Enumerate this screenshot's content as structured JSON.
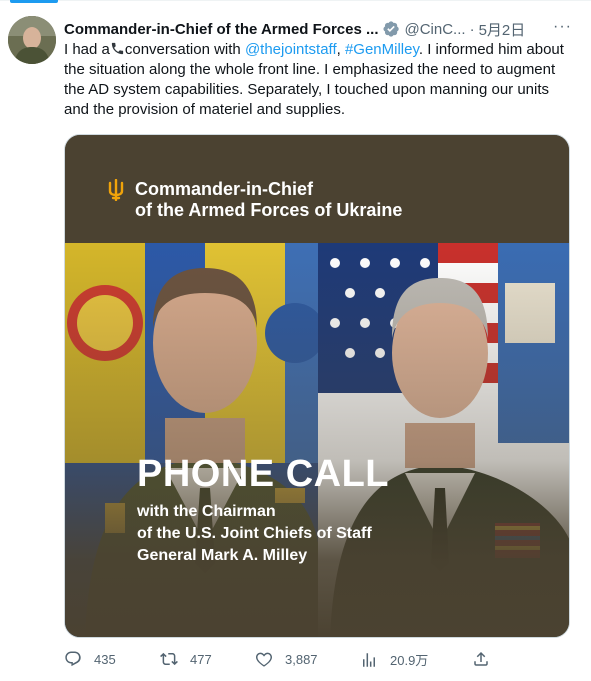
{
  "tweet": {
    "author_name": "Commander-in-Chief of the Armed Forces ...",
    "handle": "@CinC...",
    "separator": "·",
    "date": "5月2日",
    "more": "···",
    "text": {
      "part1": "I had a",
      "part2": "conversation with ",
      "mention": "@thejointstaff",
      "comma": ", ",
      "hashtag": "#GenMilley",
      "part3": ". I informed him about the situation along the whole front line. I emphasized the need to augment the AD system capabilities. Separately, I touched upon manning our units and the provision of materiel and supplies."
    }
  },
  "card": {
    "title": "Commander-in-Chief\nof the Armed Forces of Ukraine",
    "headline": "PHONE CALL",
    "line1": "with the Chairman",
    "line2": "of the U.S. Joint Chiefs of Staff",
    "line3": "General Mark A. Milley"
  },
  "actions": {
    "replies": "435",
    "retweets": "477",
    "likes": "3,887",
    "views": "20.9万"
  },
  "colors": {
    "link": "#1d9bf0",
    "secondary_text": "#536471",
    "card_bg": "#4b4231",
    "verified_badge": "#829aab"
  },
  "icons": [
    "verified-icon",
    "more-icon",
    "phone-icon",
    "trident-icon",
    "reply-icon",
    "retweet-icon",
    "like-icon",
    "views-icon",
    "share-icon"
  ]
}
